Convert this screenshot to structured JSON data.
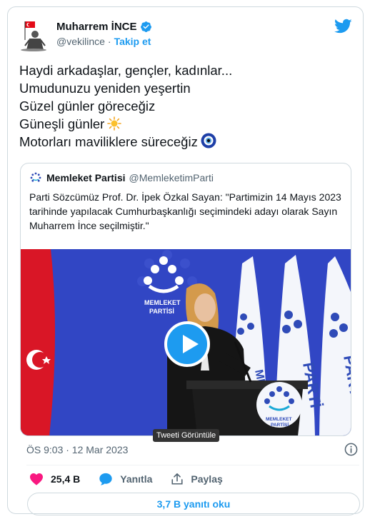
{
  "author": {
    "name": "Muharrem İNCE",
    "handle": "@vekilince",
    "separator": "·",
    "follow_label": "Takip et",
    "verified_icon": "verified-badge-icon"
  },
  "tweet": {
    "lines": [
      "Haydi arkadaşlar, gençler, kadınlar...",
      "Umudunuzu yeniden yeşertin",
      "Güzel günler göreceğiz",
      "Güneşli günler",
      "Motorları maviliklere süreceğiz"
    ],
    "sun_emoji": "sun-icon",
    "evil_eye_emoji": "nazar-icon"
  },
  "quote": {
    "name": "Memleket Partisi",
    "handle": "@MemleketimParti",
    "text": "Parti Sözcümüz Prof. Dr. İpek Özkal Sayan: \"Partimizin 14 Mayıs 2023 tarihinde yapılacak Cumhurbaşkanlığı seçimindeki adayı olarak Sayın Muharrem İnce seçilmiştir.\"",
    "media": {
      "logo_text_1": "MEMLEKET",
      "logo_text_2": "PARTİSİ",
      "flag_text_1": "MEM",
      "flag_text_2": "PARTİ",
      "podium_text_1": "MEMLEKET",
      "podium_text_2": "PARTİSİ"
    }
  },
  "tooltip": "Tweeti Görüntüle",
  "timestamp": "ÖS 9:03 · 12 Mar 2023",
  "actions": {
    "likes": "25,4 B",
    "reply": "Yanıtla",
    "share": "Paylaş"
  },
  "read_replies": "3,7 B yanıtı oku",
  "colors": {
    "accent": "#1d9bf0",
    "like": "#f91880",
    "muted": "#536471",
    "stage_blue": "#2c3ec0"
  }
}
